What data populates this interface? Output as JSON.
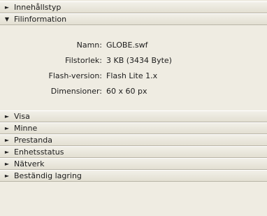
{
  "sections_top": [
    {
      "label": "Innehållstyp",
      "expanded": false,
      "arrow": "►"
    },
    {
      "label": "Filinformation",
      "expanded": true,
      "arrow": "▼"
    }
  ],
  "file_info": [
    {
      "key": "Namn:",
      "value": "GLOBE.swf"
    },
    {
      "key": "Filstorlek:",
      "value": "3 KB (3434 Byte)"
    },
    {
      "key": "Flash-version:",
      "value": "Flash Lite 1.x"
    },
    {
      "key": "Dimensioner:",
      "value": "60 x 60 px"
    }
  ],
  "sections_bottom": [
    {
      "label": "Visa",
      "expanded": false,
      "arrow": "►"
    },
    {
      "label": "Minne",
      "expanded": false,
      "arrow": "►"
    },
    {
      "label": "Prestanda",
      "expanded": false,
      "arrow": "►"
    },
    {
      "label": "Enhetsstatus",
      "expanded": false,
      "arrow": "►"
    },
    {
      "label": "Nätverk",
      "expanded": false,
      "arrow": "►"
    },
    {
      "label": "Beständig lagring",
      "expanded": false,
      "arrow": "►"
    }
  ],
  "colors": {
    "panel_bg": "#efece2",
    "header_bg_top": "#f2f0e8",
    "header_bg_bottom": "#e3dfd2",
    "header_border": "#b9b5a8"
  }
}
